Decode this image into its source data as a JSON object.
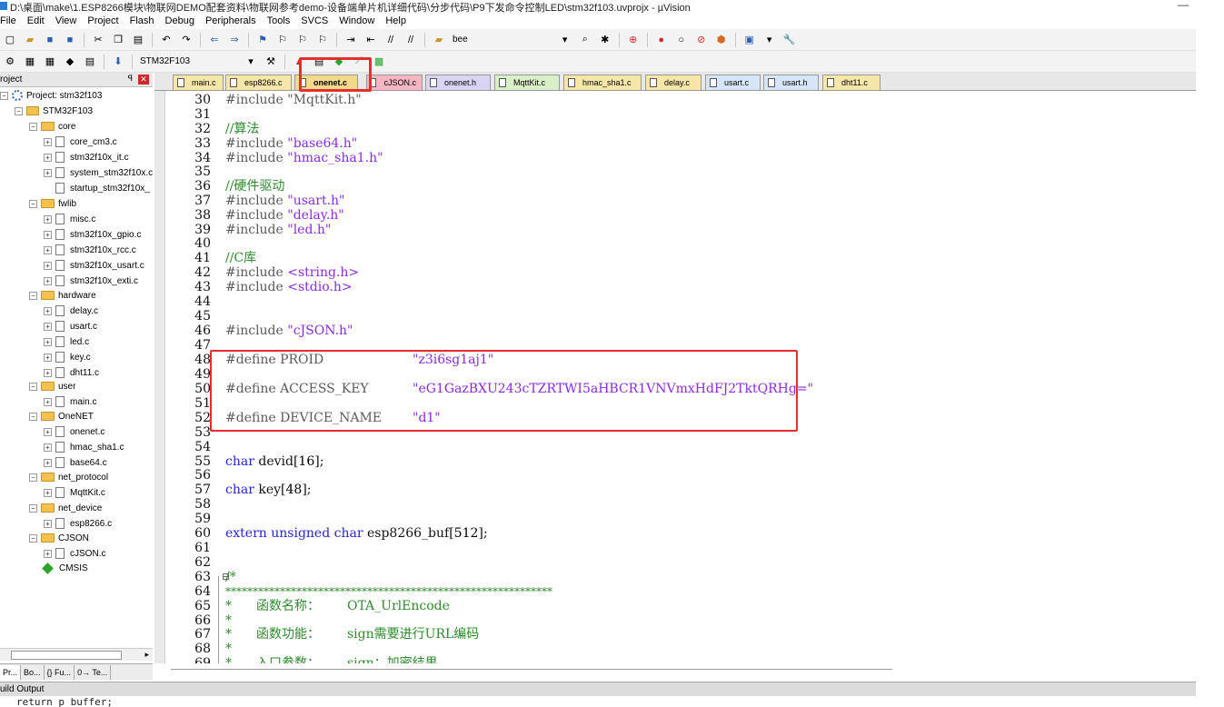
{
  "window": {
    "title": "D:\\桌面\\make\\1.ESP8266模块\\物联网DEMO配套资料\\物联网参考demo-设备端单片机详细代码\\分步代码\\P9下发命令控制LED\\stm32f103.uvprojx - µVision",
    "minimize": "—"
  },
  "menu": [
    "File",
    "Edit",
    "View",
    "Project",
    "Flash",
    "Debug",
    "Peripherals",
    "Tools",
    "SVCS",
    "Window",
    "Help"
  ],
  "toolbar": {
    "find_text": "bee",
    "target": "STM32F103"
  },
  "project_panel": {
    "header": "roject",
    "root": "Project: stm32f103",
    "target": "STM32F103",
    "groups": [
      {
        "name": "core",
        "files": [
          "core_cm3.c",
          "stm32f10x_it.c",
          "system_stm32f10x.c",
          "startup_stm32f10x_"
        ]
      },
      {
        "name": "fwlib",
        "files": [
          "misc.c",
          "stm32f10x_gpio.c",
          "stm32f10x_rcc.c",
          "stm32f10x_usart.c",
          "stm32f10x_exti.c"
        ]
      },
      {
        "name": "hardware",
        "files": [
          "delay.c",
          "usart.c",
          "led.c",
          "key.c",
          "dht11.c"
        ]
      },
      {
        "name": "user",
        "files": [
          "main.c"
        ]
      },
      {
        "name": "OneNET",
        "files": [
          "onenet.c",
          "hmac_sha1.c",
          "base64.c"
        ]
      },
      {
        "name": "net_protocol",
        "files": [
          "MqttKit.c"
        ]
      },
      {
        "name": "net_device",
        "files": [
          "esp8266.c"
        ]
      },
      {
        "name": "CJSON",
        "files": [
          "cJSON.c"
        ]
      }
    ],
    "cmsis": "CMSIS",
    "bottom_tabs": [
      "Pr...",
      "Bo...",
      "{} Fu...",
      "0→ Te..."
    ]
  },
  "editor_tabs": [
    {
      "label": "main.c",
      "color": "#f6e6a8"
    },
    {
      "label": "esp8266.c",
      "color": "#f6e6a8"
    },
    {
      "label": "onenet.c",
      "color": "#f3d98a",
      "active": true
    },
    {
      "label": "cJSON.c",
      "color": "#f4b6c2"
    },
    {
      "label": "onenet.h",
      "color": "#d9d4f3"
    },
    {
      "label": "MqttKit.c",
      "color": "#d8efc8"
    },
    {
      "label": "hmac_sha1.c",
      "color": "#f6e6a8"
    },
    {
      "label": "delay.c",
      "color": "#f6e6a8"
    },
    {
      "label": "usart.c",
      "color": "#d6e6f7"
    },
    {
      "label": "usart.h",
      "color": "#d6e6f7"
    },
    {
      "label": "dht11.c",
      "color": "#f6e6a8"
    }
  ],
  "code": {
    "l30": "#include \"MqttKit.h\"",
    "l32": "//算法",
    "l33a": "#include ",
    "l33b": "\"base64.h\"",
    "l34a": "#include ",
    "l34b": "\"hmac_sha1.h\"",
    "l36": "//硬件驱动",
    "l37a": "#include ",
    "l37b": "\"usart.h\"",
    "l38a": "#include ",
    "l38b": "\"delay.h\"",
    "l39a": "#include ",
    "l39b": "\"led.h\"",
    "l41": "//C库",
    "l42a": "#include ",
    "l42b": "<string.h>",
    "l43a": "#include ",
    "l43b": "<stdio.h>",
    "l46a": "#include ",
    "l46b": "\"cJSON.h\"",
    "l48a": "#define PROID",
    "l48b": "\"z3i6sg1aj1\"",
    "l50a": "#define ACCESS_KEY",
    "l50b": "\"eG1GazBXU243cTZRTWI5aHBCR1VNVmxHdFJ2TktQRHg=\"",
    "l52a": "#define DEVICE_NAME",
    "l52b": "\"d1\"",
    "l55a": "char",
    "l55b": " devid[",
    "l55c": "16",
    "l55d": "];",
    "l57a": "char",
    "l57b": " key[",
    "l57c": "48",
    "l57d": "];",
    "l60a": "extern unsigned char",
    "l60b": " esp8266_buf[",
    "l60c": "512",
    "l60d": "];",
    "l63": "/*",
    "l64": "************************************************************",
    "l65a": "*",
    "l65b": "函数名称：",
    "l65c": "OTA_UrlEncode",
    "l66": "*",
    "l67a": "*",
    "l67b": "函数功能：",
    "l67c": "sign需要进行URL编码",
    "l68": "*",
    "l69a": "*",
    "l69b": "入口参数：",
    "l69c": "sign：加密结果"
  },
  "line_numbers": [
    "30",
    "31",
    "32",
    "33",
    "34",
    "35",
    "36",
    "37",
    "38",
    "39",
    "40",
    "41",
    "42",
    "43",
    "44",
    "45",
    "46",
    "47",
    "48",
    "49",
    "50",
    "51",
    "52",
    "53",
    "54",
    "55",
    "56",
    "57",
    "58",
    "59",
    "60",
    "61",
    "62",
    "63",
    "64",
    "65",
    "66",
    "67",
    "68",
    "69"
  ],
  "build_output": {
    "header": "uild Output",
    "text": "return p_buffer;"
  }
}
